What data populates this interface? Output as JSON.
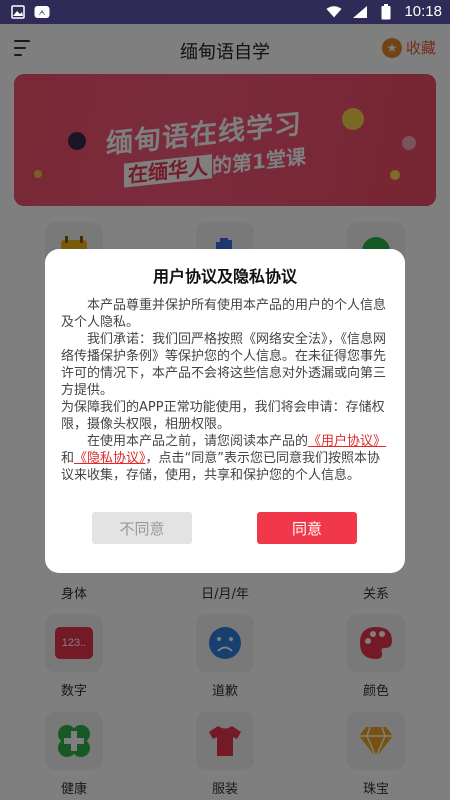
{
  "status_bar": {
    "time": "10:18"
  },
  "header": {
    "title": "缅甸语自学",
    "favorite_label": "收藏"
  },
  "banner": {
    "line1": "缅甸语在线学习",
    "line2_pre": "在缅华人",
    "line2_post": "的第1堂课"
  },
  "grid": {
    "row1": [
      {
        "label": "身体"
      },
      {
        "label": "日/月/年"
      },
      {
        "label": "关系"
      }
    ],
    "row2": [
      {
        "label": "数字",
        "tile_text": "123.."
      },
      {
        "label": "道歉"
      },
      {
        "label": "颜色"
      }
    ],
    "row3": [
      {
        "label": "健康"
      },
      {
        "label": "服装"
      },
      {
        "label": "珠宝"
      }
    ]
  },
  "dialog": {
    "title": "用户协议及隐私协议",
    "p1": "本产品尊重并保护所有使用本产品的用户的个人信息及个人隐私。",
    "p2": "我们承诺：我们回严格按照《网络安全法》，《信息网络传播保护条例》等保护您的个人信息。在未征得您事先许可的情况下，本产品不会将这些信息对外透漏或向第三方提供。",
    "p3": "为保障我们的APP正常功能使用，我们将会申请：存储权限，摄像头权限，相册权限。",
    "p4_a": "在使用本产品之前，请您阅读本产品的",
    "user_agreement_link": "《用户协议》",
    "p4_and": "和",
    "privacy_link": "《隐私协议》",
    "p4_b": "，点击“同意”表示您已同意我们按照本协议来收集，存储，使用，共享和保护您的个人信息。",
    "disagree_label": "不同意",
    "agree_label": "同意"
  },
  "colors": {
    "status_bar": "#2e2c57",
    "accent": "#f0384a",
    "banner": "#f2506a"
  }
}
